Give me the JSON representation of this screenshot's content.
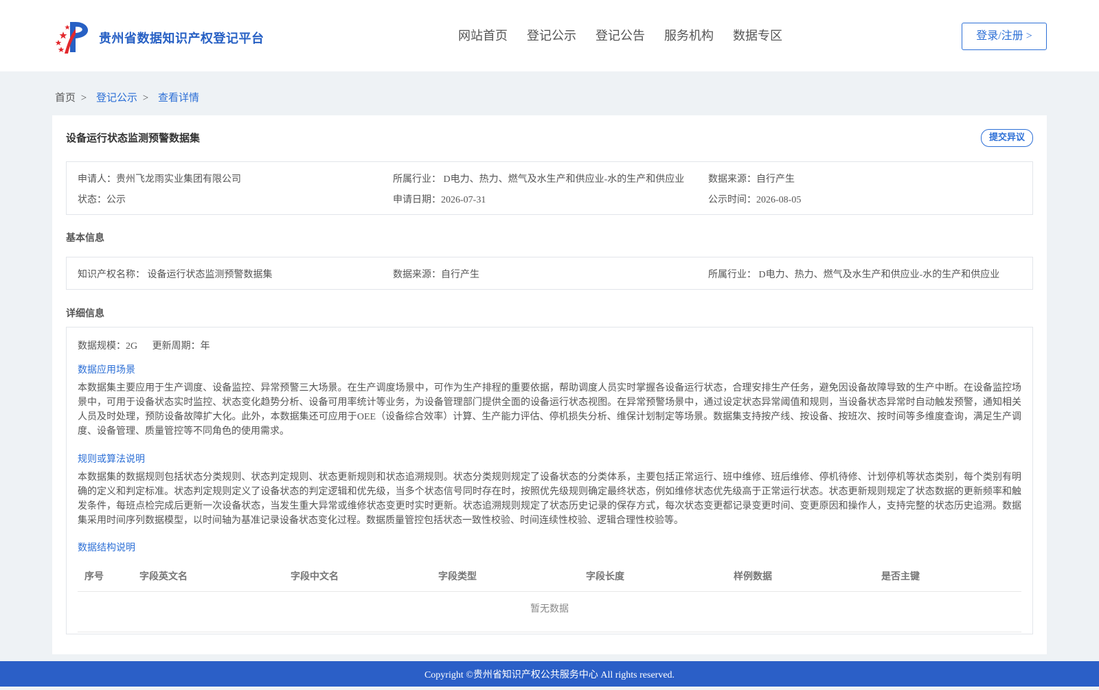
{
  "header": {
    "site_title": "贵州省数据知识产权登记平台",
    "nav": [
      "网站首页",
      "登记公示",
      "登记公告",
      "服务机构",
      "数据专区"
    ],
    "login_label": "登录/注册 >"
  },
  "breadcrumb": {
    "home": "首页",
    "publicity": "登记公示",
    "current": "查看详情",
    "separator": ">"
  },
  "dataset": {
    "title": "设备运行状态监测预警数据集",
    "objection_label": "提交异议",
    "applicant": "申请人：贵州飞龙雨实业集团有限公司",
    "industry": "所属行业： D电力、热力、燃气及水生产和供应业-水的生产和供应业",
    "data_source": "数据来源：自行产生",
    "status": "状态：公示",
    "apply_date": "申请日期：2026-07-31",
    "publish_time": "公示时间：2026-08-05"
  },
  "basic_info": {
    "title": "基本信息",
    "ip_name": "知识产权名称： 设备运行状态监测预警数据集",
    "data_source": "数据来源：自行产生",
    "industry": "所属行业： D电力、热力、燃气及水生产和供应业-水的生产和供应业"
  },
  "detail_info": {
    "title": "详细信息",
    "scale": "数据规模：2G",
    "update_cycle": "更新周期：年",
    "scenario_title": "数据应用场景",
    "scenario_text": "本数据集主要应用于生产调度、设备监控、异常预警三大场景。在生产调度场景中，可作为生产排程的重要依据，帮助调度人员实时掌握各设备运行状态，合理安排生产任务，避免因设备故障导致的生产中断。在设备监控场景中，可用于设备状态实时监控、状态变化趋势分析、设备可用率统计等业务，为设备管理部门提供全面的设备运行状态视图。在异常预警场景中，通过设定状态异常阈值和规则，当设备状态异常时自动触发预警，通知相关人员及时处理，预防设备故障扩大化。此外，本数据集还可应用于OEE（设备综合效率）计算、生产能力评估、停机损失分析、维保计划制定等场景。数据集支持按产线、按设备、按班次、按时间等多维度查询，满足生产调度、设备管理、质量管控等不同角色的使用需求。",
    "rules_title": "规则或算法说明",
    "rules_text": "本数据集的数据规则包括状态分类规则、状态判定规则、状态更新规则和状态追溯规则。状态分类规则规定了设备状态的分类体系，主要包括正常运行、班中维修、班后维修、停机待修、计划停机等状态类别，每个类别有明确的定义和判定标准。状态判定规则定义了设备状态的判定逻辑和优先级，当多个状态信号同时存在时，按照优先级规则确定最终状态，例如维修状态优先级高于正常运行状态。状态更新规则规定了状态数据的更新频率和触发条件，每班点检完成后更新一次设备状态，当发生重大异常或维修状态变更时实时更新。状态追溯规则规定了状态历史记录的保存方式，每次状态变更都记录变更时间、变更原因和操作人，支持完整的状态历史追溯。数据集采用时间序列数据模型，以时间轴为基准记录设备状态变化过程。数据质量管控包括状态一致性校验、时间连续性校验、逻辑合理性校验等。",
    "structure_title": "数据结构说明",
    "table_headers": [
      "序号",
      "字段英文名",
      "字段中文名",
      "字段类型",
      "字段长度",
      "样例数据",
      "是否主键"
    ],
    "empty_text": "暂无数据"
  },
  "footer": {
    "copyright": "Copyright ©贵州省知识产权公共服务中心 All rights reserved."
  },
  "colors": {
    "accent": "#2c6fd6",
    "footer_bg": "#2b5fc7",
    "page_bg": "#eef2f5",
    "logo_red": "#e2282d"
  }
}
